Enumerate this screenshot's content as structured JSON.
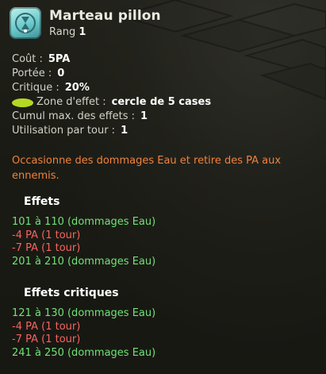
{
  "spell": {
    "name": "Marteau pillon",
    "rank_label": "Rang",
    "rank_value": "1",
    "icon": "hourglass-ability-icon"
  },
  "stats": {
    "cost_label": "Coût :",
    "cost_value": "5PA",
    "range_label": "Portée :",
    "range_value": "0",
    "crit_label": "Critique :",
    "crit_value": "20%",
    "zone_label": "Zone d'effet :",
    "zone_value": "cercle de 5 cases",
    "zone_icon": "aoe-ellipse-icon",
    "cumul_label": "Cumul max. des effets :",
    "cumul_value": "1",
    "use_label": "Utilisation par tour :",
    "use_value": "1"
  },
  "description": "Occasionne des dommages Eau et retire des PA aux ennemis.",
  "effects": {
    "title": "Effets",
    "lines": [
      "101 à 110 (dommages Eau)",
      "-4 PA (1 tour)",
      "-7 PA (1 tour)",
      "201 à 210 (dommages Eau)"
    ]
  },
  "critical_effects": {
    "title": "Effets critiques",
    "lines": [
      "121 à 130 (dommages Eau)",
      "-4 PA (1 tour)",
      "-7 PA (1 tour)",
      "241 à 250 (dommages Eau)"
    ]
  },
  "colors": {
    "positive": "#6fe277",
    "negative": "#f6645f",
    "description": "#f0823a",
    "zone_icon": "#b5d823"
  }
}
